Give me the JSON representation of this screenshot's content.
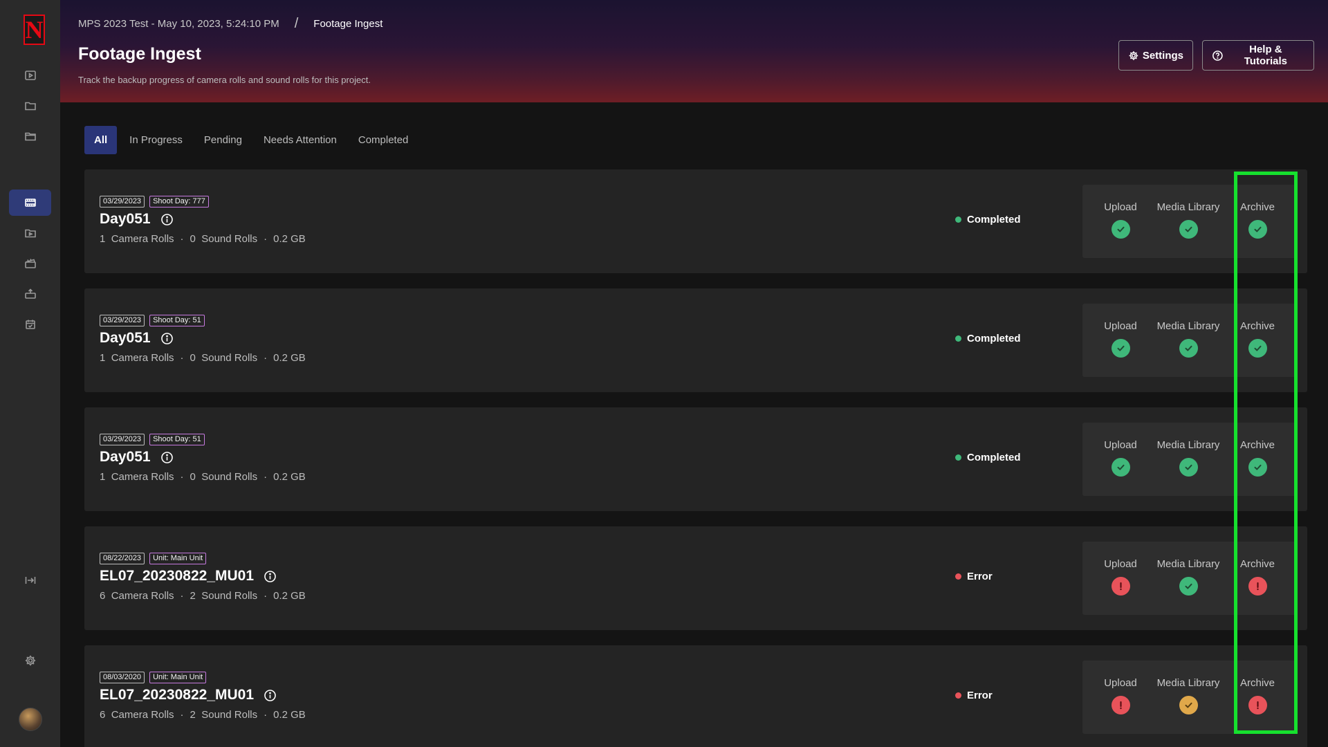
{
  "app": {
    "logo_letter": "N",
    "brand_color": "#e50914",
    "accent_color": "#2f3b78"
  },
  "sidebar": {
    "items": [
      {
        "icon": "play-square-icon"
      },
      {
        "icon": "folder-icon"
      },
      {
        "icon": "folder-outline-icon"
      },
      {
        "icon": "film-strip-icon",
        "active": true
      },
      {
        "icon": "video-folder-icon"
      },
      {
        "icon": "clapperboard-icon"
      },
      {
        "icon": "camera-upload-icon"
      },
      {
        "icon": "calendar-check-icon"
      }
    ],
    "collapse_icon": "collapse-panel-icon",
    "settings_icon": "gear-icon"
  },
  "header": {
    "breadcrumb_project": "MPS 2023 Test - May 10, 2023, 5:24:10 PM",
    "breadcrumb_separator": "/",
    "breadcrumb_current": "Footage Ingest",
    "title": "Footage Ingest",
    "subtitle": "Track the backup progress of camera rolls and sound rolls for this project.",
    "settings_label": "Settings",
    "help_label": "Help & Tutorials"
  },
  "tabs": [
    {
      "label": "All",
      "active": true
    },
    {
      "label": "In Progress"
    },
    {
      "label": "Pending"
    },
    {
      "label": "Needs Attention"
    },
    {
      "label": "Completed"
    }
  ],
  "stage_labels": {
    "upload": "Upload",
    "media": "Media Library",
    "archive": "Archive"
  },
  "meta_labels": {
    "camera": "Camera Rolls",
    "sound": "Sound Rolls",
    "dot": "·"
  },
  "cards": [
    {
      "date": "03/29/2023",
      "tag": "Shoot Day: 777",
      "title": "Day051",
      "camera_rolls": "1",
      "sound_rolls": "0",
      "size": "0.2 GB",
      "status": "Completed",
      "status_color": "#3fb87a",
      "upload": "ok",
      "media": "ok",
      "archive": "ok"
    },
    {
      "date": "03/29/2023",
      "tag": "Shoot Day: 51",
      "title": "Day051",
      "camera_rolls": "1",
      "sound_rolls": "0",
      "size": "0.2 GB",
      "status": "Completed",
      "status_color": "#3fb87a",
      "upload": "ok",
      "media": "ok",
      "archive": "ok"
    },
    {
      "date": "03/29/2023",
      "tag": "Shoot Day: 51",
      "title": "Day051",
      "camera_rolls": "1",
      "sound_rolls": "0",
      "size": "0.2 GB",
      "status": "Completed",
      "status_color": "#3fb87a",
      "upload": "ok",
      "media": "ok",
      "archive": "ok"
    },
    {
      "date": "08/22/2023",
      "tag": "Unit: Main Unit",
      "title": "EL07_20230822_MU01",
      "camera_rolls": "6",
      "sound_rolls": "2",
      "size": "0.2 GB",
      "status": "Error",
      "status_color": "#e8535a",
      "upload": "err",
      "media": "ok",
      "archive": "err"
    },
    {
      "date": "08/03/2020",
      "tag": "Unit: Main Unit",
      "title": "EL07_20230822_MU01",
      "camera_rolls": "6",
      "sound_rolls": "2",
      "size": "0.2 GB",
      "status": "Error",
      "status_color": "#e8535a",
      "upload": "err",
      "media": "warn",
      "archive": "err"
    }
  ],
  "highlight_color": "#16e12e"
}
